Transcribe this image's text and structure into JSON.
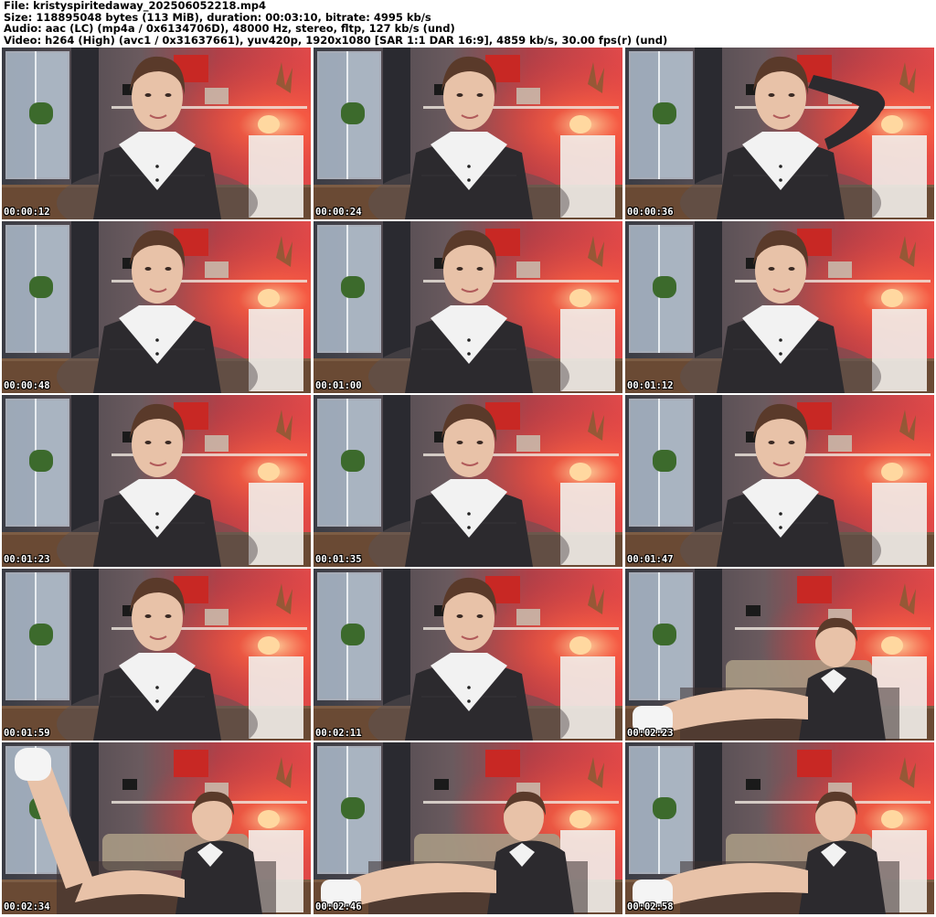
{
  "header": {
    "line1": "File: kristyspiritedaway_202506052218.mp4",
    "line2": "Size: 118895048 bytes (113 MiB), duration: 00:03:10, bitrate: 4995 kb/s",
    "line3": "Audio: aac (LC) (mp4a / 0x6134706D), 48000 Hz, stereo, fltp, 127 kb/s (und)",
    "line4": "Video: h264 (High) (avc1 / 0x31637661), yuv420p, 1920x1080 [SAR 1:1 DAR 16:9], 4859 kb/s, 30.00 fps(r) (und)"
  },
  "thumbnails": [
    {
      "time": "00:00:12",
      "pose": "seated"
    },
    {
      "time": "00:00:24",
      "pose": "seated"
    },
    {
      "time": "00:00:36",
      "pose": "arm-raised"
    },
    {
      "time": "00:00:48",
      "pose": "seated"
    },
    {
      "time": "00:01:00",
      "pose": "seated"
    },
    {
      "time": "00:01:12",
      "pose": "seated"
    },
    {
      "time": "00:01:23",
      "pose": "seated"
    },
    {
      "time": "00:01:35",
      "pose": "seated"
    },
    {
      "time": "00:01:47",
      "pose": "seated"
    },
    {
      "time": "00:01:59",
      "pose": "seated"
    },
    {
      "time": "00:02:11",
      "pose": "seated"
    },
    {
      "time": "00:02:23",
      "pose": "reclined"
    },
    {
      "time": "00:02:34",
      "pose": "leg-raised"
    },
    {
      "time": "00:02:46",
      "pose": "reclined"
    },
    {
      "time": "00:02:58",
      "pose": "reclined"
    }
  ],
  "colors": {
    "wall_red": "#d8343c",
    "lamp": "#ffd8a0",
    "sweater": "#2c2a2e",
    "collar": "#f2f2f2",
    "skin": "#e8c2a8",
    "hair": "#5a3a2a"
  }
}
